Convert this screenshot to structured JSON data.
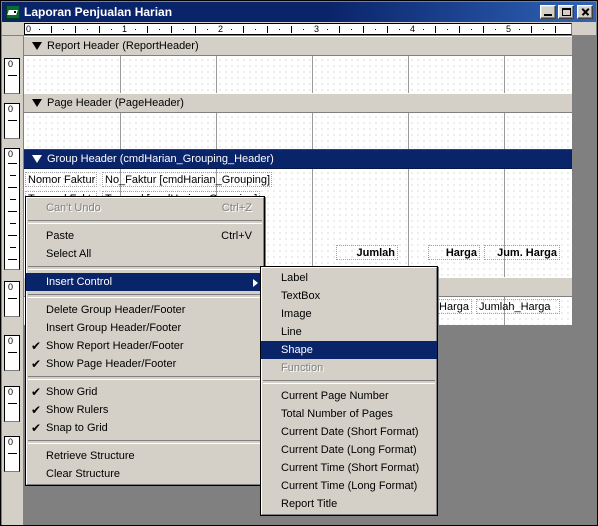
{
  "window": {
    "title": "Laporan Penjualan Harian",
    "icon": "report-icon",
    "caption_buttons": [
      {
        "name": "minimize",
        "glyph": "minimize-icon"
      },
      {
        "name": "maximize",
        "glyph": "maximize-icon"
      },
      {
        "name": "close",
        "glyph": "close-icon"
      }
    ]
  },
  "rulers": {
    "horizontal_numbers": [
      "0",
      "1",
      "2",
      "3",
      "4",
      "5"
    ],
    "vertical_numbers": [
      "0",
      "0",
      "0",
      "0",
      "0",
      "0",
      "0"
    ]
  },
  "designer": {
    "bands": [
      {
        "label": "Report Header (ReportHeader)",
        "selected": false
      },
      {
        "label": "Page Header (PageHeader)",
        "selected": false
      },
      {
        "label": "Group Header (cmdHarian_Grouping_Header)",
        "selected": true
      }
    ],
    "controls": [
      {
        "text": "Nomor Faktur :",
        "type": "label"
      },
      {
        "text": "No_Faktur [cmdHarian_Grouping]",
        "type": "field"
      },
      {
        "text": "Tanggal Faktur :",
        "type": "label"
      },
      {
        "text": "Tanggal [cmdHarian_Grouping]",
        "type": "field"
      },
      {
        "text": "Jumlah",
        "type": "column-header"
      },
      {
        "text": "Harga",
        "type": "column-header"
      },
      {
        "text": "Jum. Harga",
        "type": "column-header"
      },
      {
        "text": "Jumlah",
        "type": "column-header-occluded"
      },
      {
        "text": "Harga",
        "type": "field"
      },
      {
        "text": "Jumlah_Harga",
        "type": "field"
      }
    ]
  },
  "context_menu": {
    "items": [
      {
        "label": "Can't Undo",
        "accel": "Ctrl+Z",
        "disabled": true,
        "checked": false,
        "submenu": false
      },
      {
        "separator": true
      },
      {
        "label": "Paste",
        "accel": "Ctrl+V",
        "disabled": false,
        "checked": false,
        "submenu": false
      },
      {
        "label": "Select All",
        "accel": "",
        "disabled": false,
        "checked": false,
        "submenu": false
      },
      {
        "separator": true
      },
      {
        "label": "Insert Control",
        "accel": "",
        "disabled": false,
        "checked": false,
        "submenu": true,
        "highlighted": true
      },
      {
        "separator": true
      },
      {
        "label": "Delete Group Header/Footer",
        "accel": "",
        "disabled": false,
        "checked": false,
        "submenu": false
      },
      {
        "label": "Insert Group Header/Footer",
        "accel": "",
        "disabled": false,
        "checked": false,
        "submenu": false
      },
      {
        "label": "Show Report Header/Footer",
        "accel": "",
        "disabled": false,
        "checked": true,
        "submenu": false
      },
      {
        "label": "Show Page Header/Footer",
        "accel": "",
        "disabled": false,
        "checked": true,
        "submenu": false
      },
      {
        "separator": true
      },
      {
        "label": "Show Grid",
        "accel": "",
        "disabled": false,
        "checked": true,
        "submenu": false
      },
      {
        "label": "Show Rulers",
        "accel": "",
        "disabled": false,
        "checked": true,
        "submenu": false
      },
      {
        "label": "Snap to Grid",
        "accel": "",
        "disabled": false,
        "checked": true,
        "submenu": false
      },
      {
        "separator": true
      },
      {
        "label": "Retrieve Structure",
        "accel": "",
        "disabled": false,
        "checked": false,
        "submenu": false
      },
      {
        "label": "Clear Structure",
        "accel": "",
        "disabled": false,
        "checked": false,
        "submenu": false
      }
    ]
  },
  "submenu": {
    "items": [
      {
        "label": "Label",
        "disabled": false,
        "highlighted": false
      },
      {
        "label": "TextBox",
        "disabled": false,
        "highlighted": false
      },
      {
        "label": "Image",
        "disabled": false,
        "highlighted": false
      },
      {
        "label": "Line",
        "disabled": false,
        "highlighted": false
      },
      {
        "label": "Shape",
        "disabled": false,
        "highlighted": true
      },
      {
        "label": "Function",
        "disabled": true,
        "highlighted": false
      },
      {
        "separator": true
      },
      {
        "label": "Current Page Number",
        "disabled": false,
        "highlighted": false
      },
      {
        "label": "Total Number of Pages",
        "disabled": false,
        "highlighted": false
      },
      {
        "label": "Current Date (Short Format)",
        "disabled": false,
        "highlighted": false
      },
      {
        "label": "Current Date (Long Format)",
        "disabled": false,
        "highlighted": false
      },
      {
        "label": "Current Time (Short Format)",
        "disabled": false,
        "highlighted": false
      },
      {
        "label": "Current Time (Long Format)",
        "disabled": false,
        "highlighted": false
      },
      {
        "label": "Report Title",
        "disabled": false,
        "highlighted": false
      }
    ]
  },
  "colors": {
    "title_active": "#0a246a",
    "face": "#d4d0c8",
    "selection": "#0a246a",
    "surface_bg": "#808080"
  }
}
